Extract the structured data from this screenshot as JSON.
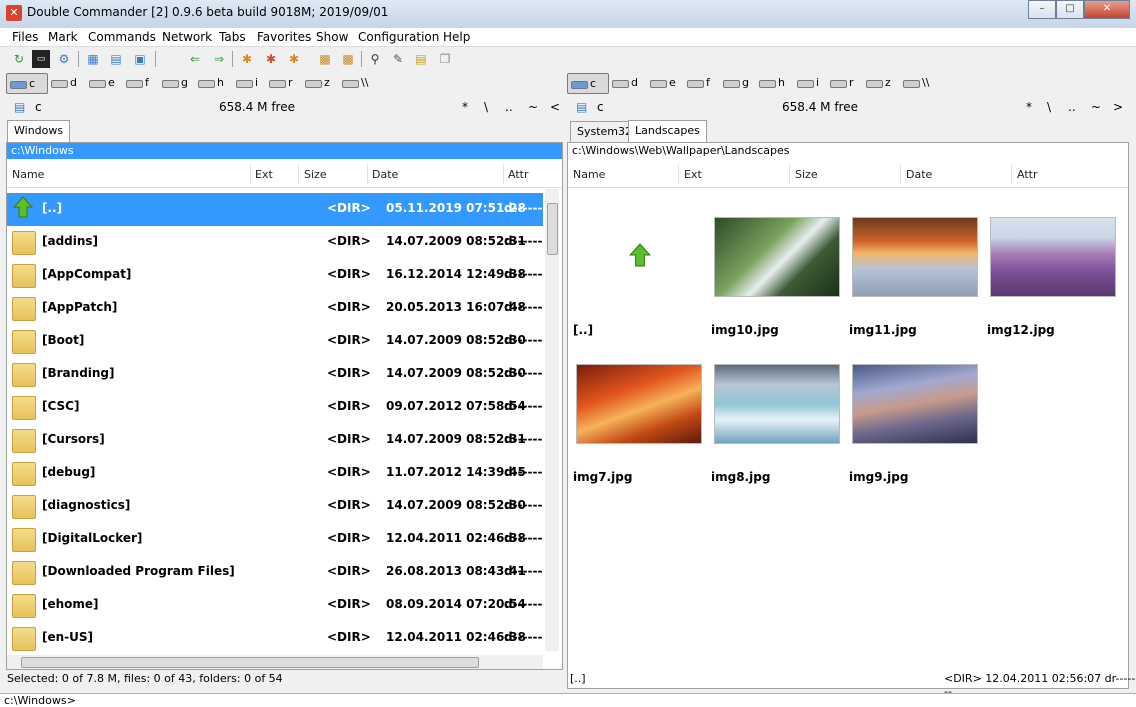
{
  "window": {
    "title": "Double Commander [2] 0.9.6 beta build 9018M; 2019/09/01",
    "minimize": "–",
    "maximize": "□",
    "close": "✕"
  },
  "menu": [
    "Files",
    "Mark",
    "Commands",
    "Network",
    "Tabs",
    "Favorites",
    "Show",
    "Configuration",
    "Help"
  ],
  "drives": [
    "c",
    "d",
    "e",
    "f",
    "g",
    "h",
    "i",
    "r",
    "z",
    "\\\\"
  ],
  "left": {
    "drive": "c",
    "free": "658.4 M free",
    "nav": [
      "*",
      "\\",
      "..",
      "~",
      "<"
    ],
    "tabs": [
      "Windows"
    ],
    "path": "c:\\Windows",
    "columns": [
      "Name",
      "Ext",
      "Size",
      "Date",
      "Attr"
    ],
    "rows": [
      {
        "name": "[..]",
        "size": "<DIR>",
        "date": "05.11.2019 07:51:28",
        "attr": "d------"
      },
      {
        "name": "[addins]",
        "size": "<DIR>",
        "date": "14.07.2009 08:52:31",
        "attr": "d------"
      },
      {
        "name": "[AppCompat]",
        "size": "<DIR>",
        "date": "16.12.2014 12:49:38",
        "attr": "d------"
      },
      {
        "name": "[AppPatch]",
        "size": "<DIR>",
        "date": "20.05.2013 16:07:48",
        "attr": "d------"
      },
      {
        "name": "[Boot]",
        "size": "<DIR>",
        "date": "14.07.2009 08:52:30",
        "attr": "d------"
      },
      {
        "name": "[Branding]",
        "size": "<DIR>",
        "date": "14.07.2009 08:52:30",
        "attr": "d------"
      },
      {
        "name": "[CSC]",
        "size": "<DIR>",
        "date": "09.07.2012 07:58:54",
        "attr": "d------"
      },
      {
        "name": "[Cursors]",
        "size": "<DIR>",
        "date": "14.07.2009 08:52:31",
        "attr": "d------"
      },
      {
        "name": "[debug]",
        "size": "<DIR>",
        "date": "11.07.2012 14:39:45",
        "attr": "d------"
      },
      {
        "name": "[diagnostics]",
        "size": "<DIR>",
        "date": "14.07.2009 08:52:30",
        "attr": "d------"
      },
      {
        "name": "[DigitalLocker]",
        "size": "<DIR>",
        "date": "12.04.2011 02:46:38",
        "attr": "d------"
      },
      {
        "name": "[Downloaded Program Files]",
        "size": "<DIR>",
        "date": "26.08.2013 08:43:41",
        "attr": "d------"
      },
      {
        "name": "[ehome]",
        "size": "<DIR>",
        "date": "08.09.2014 07:20:54",
        "attr": "d------"
      },
      {
        "name": "[en-US]",
        "size": "<DIR>",
        "date": "12.04.2011 02:46:38",
        "attr": "d------"
      }
    ],
    "status": "Selected: 0 of 7.8 M, files: 0 of 43, folders: 0 of 54"
  },
  "right": {
    "drive": "c",
    "free": "658.4 M free",
    "nav": [
      "*",
      "\\",
      "..",
      "~",
      ">"
    ],
    "tabs": [
      "System32",
      "Landscapes"
    ],
    "path": "c:\\Windows\\Web\\Wallpaper\\Landscapes",
    "columns": [
      "Name",
      "Ext",
      "Size",
      "Date",
      "Attr"
    ],
    "thumbs": [
      "[..]",
      "img10.jpg",
      "img11.jpg",
      "img12.jpg",
      "img7.jpg",
      "img8.jpg",
      "img9.jpg"
    ],
    "status_name": "[..]",
    "status_info": "<DIR>  12.04.2011 02:56:07  dr-------"
  },
  "cmdline": "c:\\Windows>"
}
